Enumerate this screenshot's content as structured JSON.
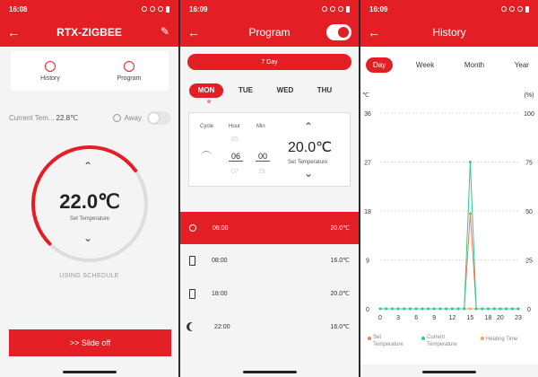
{
  "status": {
    "time1": "16:08",
    "time2": "16:09",
    "time3": "16:09"
  },
  "colors": {
    "brand": "#e41e25",
    "current_temp": "#2ecc8f",
    "heating_time": "#f5a25d",
    "set_temp": "#f07b5f"
  },
  "screen1": {
    "title": "RTX-ZIGBEE",
    "tabs": [
      {
        "label": "History",
        "icon": "clock-icon"
      },
      {
        "label": "Program",
        "icon": "program-icon"
      }
    ],
    "current_label": "Current Tem...",
    "current_value": "22.8℃",
    "away_label": "Away",
    "set_temp": "22.0℃",
    "set_temp_label": "Set Temperature",
    "setpoint_level_fraction": 0.7,
    "schedule_note": "USING SCHEDULE",
    "slide_label": ">> Slide off"
  },
  "screen2": {
    "title": "Program",
    "mode": "7 Day",
    "days": [
      "MON",
      "TUE",
      "WED",
      "THU"
    ],
    "active_day": "MON",
    "editor": {
      "cycle_label": "Cycle",
      "hour_label": "Hour",
      "min_label": "Min",
      "hour_prev": "05",
      "hour_sel": "06",
      "hour_next": "07",
      "min_prev": "",
      "min_sel": "00",
      "min_next": "15",
      "temp": "20.0℃",
      "temp_label": "Set Temperature"
    },
    "schedule": [
      {
        "time": "06:00",
        "temp": "20.0℃",
        "icon": "sunrise-icon"
      },
      {
        "time": "08:00",
        "temp": "16.0℃",
        "icon": "door-out-icon"
      },
      {
        "time": "18:00",
        "temp": "20.0℃",
        "icon": "door-in-icon"
      },
      {
        "time": "22:00",
        "temp": "16.0℃",
        "icon": "moon-icon"
      }
    ]
  },
  "screen3": {
    "title": "History",
    "ranges": [
      "Day",
      "Week",
      "Month",
      "Year"
    ],
    "active_range": "Day",
    "unit_left": "℃",
    "unit_right": "(%)",
    "left_ticks": [
      "36",
      "27",
      "18",
      "9",
      "0"
    ],
    "right_ticks": [
      "100",
      "75",
      "50",
      "25",
      "0"
    ],
    "x_ticks": [
      "0",
      "3",
      "6",
      "9",
      "12",
      "15",
      "18",
      "20",
      "23"
    ],
    "legend": [
      "Set Temperature",
      "Current Temperature",
      "Heating Time"
    ]
  },
  "chart_data": {
    "type": "line",
    "x": [
      0,
      1,
      2,
      3,
      4,
      5,
      6,
      7,
      8,
      9,
      10,
      11,
      12,
      13,
      14,
      15,
      16,
      17,
      18,
      19,
      20,
      21,
      22,
      23
    ],
    "ylim": [
      0,
      36
    ],
    "y2lim": [
      0,
      100
    ],
    "series": [
      {
        "name": "Set Temperature",
        "values": [
          0,
          0,
          0,
          0,
          0,
          0,
          0,
          0,
          0,
          0,
          0,
          0,
          0,
          0,
          0,
          17.5,
          0,
          0,
          0,
          0,
          0,
          0,
          0,
          0
        ]
      },
      {
        "name": "Current Temperature",
        "values": [
          0,
          0,
          0,
          0,
          0,
          0,
          0,
          0,
          0,
          0,
          0,
          0,
          0,
          0,
          0,
          27,
          0,
          0,
          0,
          0,
          0,
          0,
          0,
          0
        ]
      },
      {
        "name": "Heating Time",
        "values": [
          0,
          0,
          0,
          0,
          0,
          0,
          0,
          0,
          0,
          0,
          0,
          0,
          0,
          0,
          0,
          0,
          0,
          0,
          0,
          0,
          0,
          0,
          0,
          0
        ]
      }
    ]
  }
}
